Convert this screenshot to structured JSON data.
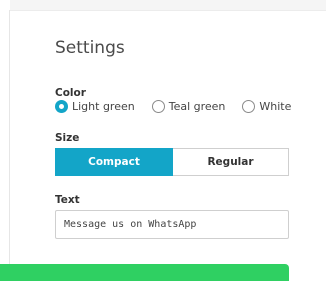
{
  "settings": {
    "title": "Settings",
    "color": {
      "label": "Color",
      "options": [
        {
          "label": "Light green",
          "selected": true
        },
        {
          "label": "Teal green",
          "selected": false
        },
        {
          "label": "White",
          "selected": false
        }
      ],
      "accent": "#13a5c8"
    },
    "size": {
      "label": "Size",
      "options": [
        "Compact",
        "Regular"
      ],
      "selected": "Compact"
    },
    "text": {
      "label": "Text",
      "value": "Message us on WhatsApp"
    }
  },
  "colors": {
    "bottom_bar": "#2fd062"
  }
}
